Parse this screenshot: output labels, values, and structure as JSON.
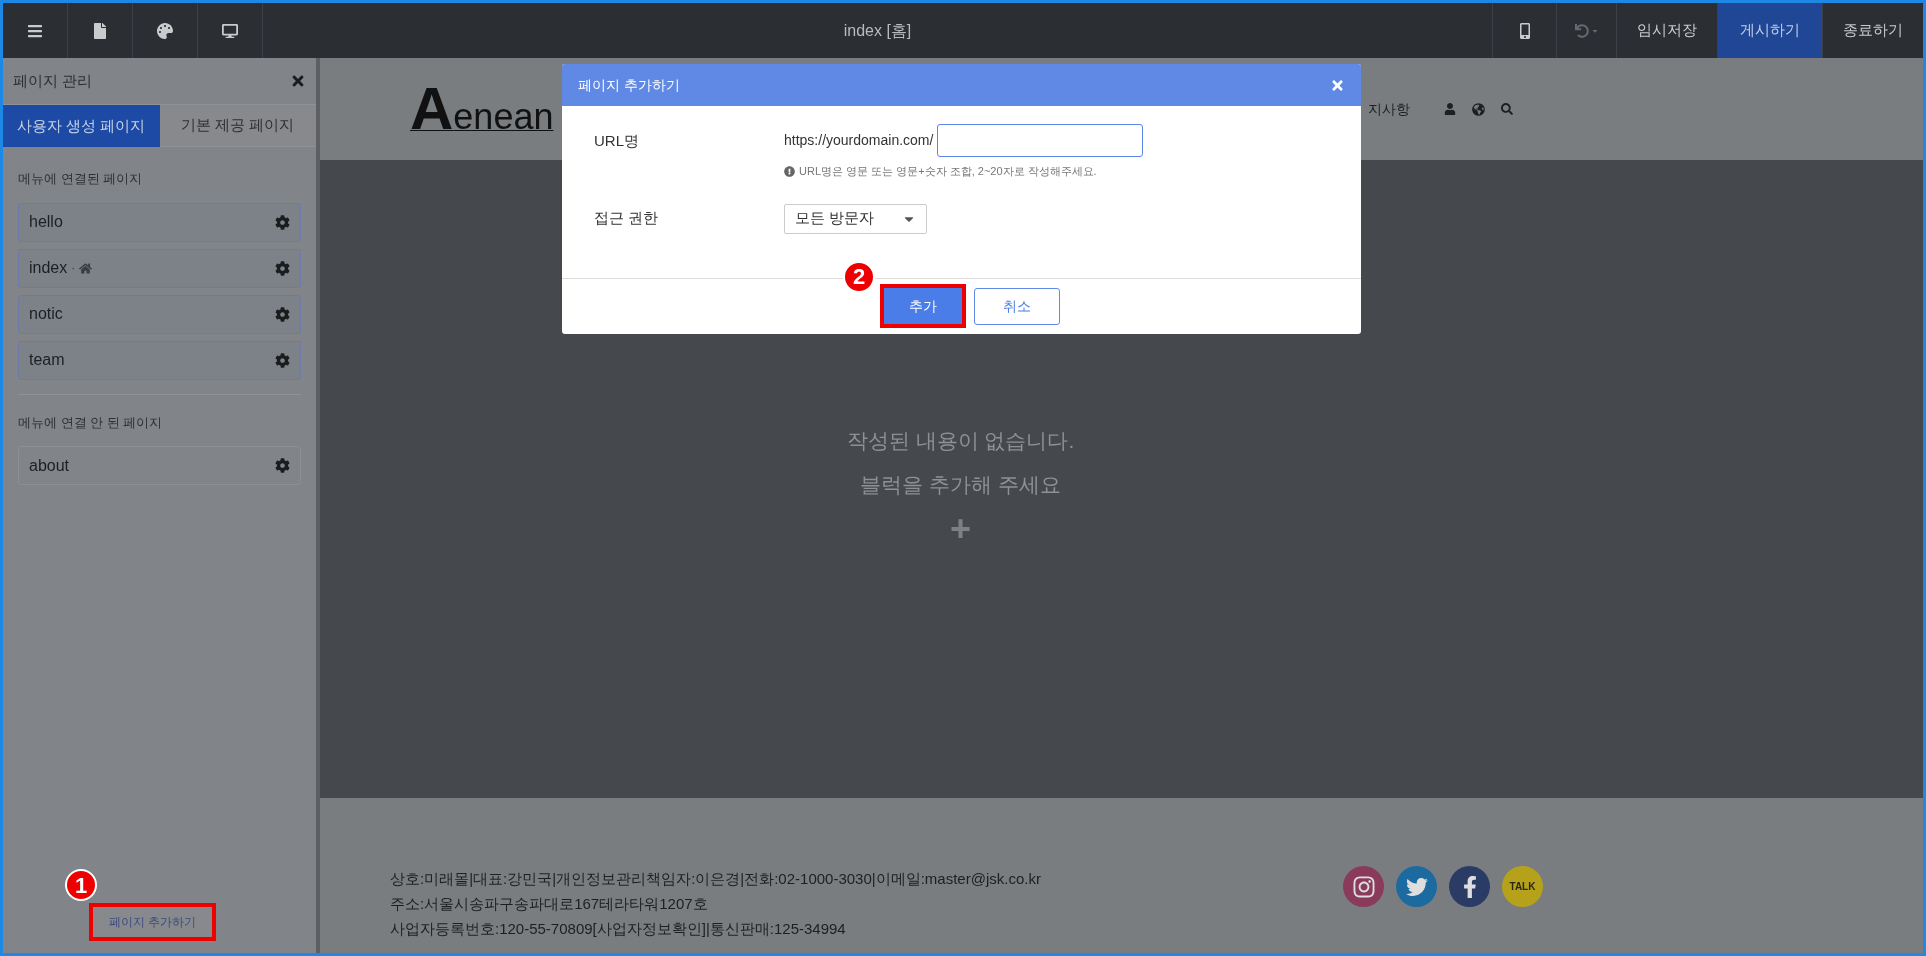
{
  "topbar": {
    "title": "index [홈]",
    "buttons": [
      {
        "label": "임시저장",
        "selected": false
      },
      {
        "label": "게시하기",
        "selected": true
      },
      {
        "label": "종료하기",
        "selected": false
      }
    ]
  },
  "sidebar": {
    "title": "페이지 관리",
    "tabs": [
      {
        "label": "사용자 생성 페이지",
        "selected": true
      },
      {
        "label": "기본 제공 페이지",
        "selected": false
      }
    ],
    "sections": [
      {
        "heading": "메뉴에 연결된 페이지",
        "linked": true,
        "pages": [
          {
            "name": "hello",
            "home": false
          },
          {
            "name": "index",
            "home": true,
            "separator": "·"
          },
          {
            "name": "notic",
            "home": false
          },
          {
            "name": "team",
            "home": false
          }
        ]
      },
      {
        "heading": "메뉴에 연결 안 된 페이지",
        "linked": false,
        "pages": [
          {
            "name": "about",
            "home": false
          }
        ]
      }
    ],
    "add_button": "페이지 추가하기"
  },
  "site": {
    "logo": {
      "initial": "A",
      "rest": "enean"
    },
    "nav_item": "지사항",
    "empty_message": [
      "작성된 내용이 없습니다.",
      "블럭을 추가해 주세요"
    ],
    "add_block": "+",
    "footer_lines": [
      "상호:미래몰|대표:강민국|개인정보관리책임자:이은경|전화:02-1000-3030|이메일:master@jsk.co.kr",
      "주소:서울시송파구송파대로167테라타워1207호",
      "사업자등록번호:120-55-70809[사업자정보확인]|통신판매:125-34994"
    ],
    "kakao_label": "TALK"
  },
  "dialog": {
    "title": "페이지 추가하기",
    "fields": [
      {
        "kind": "text",
        "label": "URL명",
        "prefix": "https://yourdomain.com/",
        "hint": "URL명은 영문 또는 영문+숫자 조합, 2~20자로 작성해주세요."
      },
      {
        "kind": "select",
        "label": "접근 권한",
        "value": "모든 방문자"
      }
    ],
    "buttons": [
      {
        "label": "추가",
        "primary": true
      },
      {
        "label": "취소",
        "primary": false
      }
    ]
  },
  "annotations": [
    {
      "number": "1"
    },
    {
      "number": "2"
    }
  ]
}
